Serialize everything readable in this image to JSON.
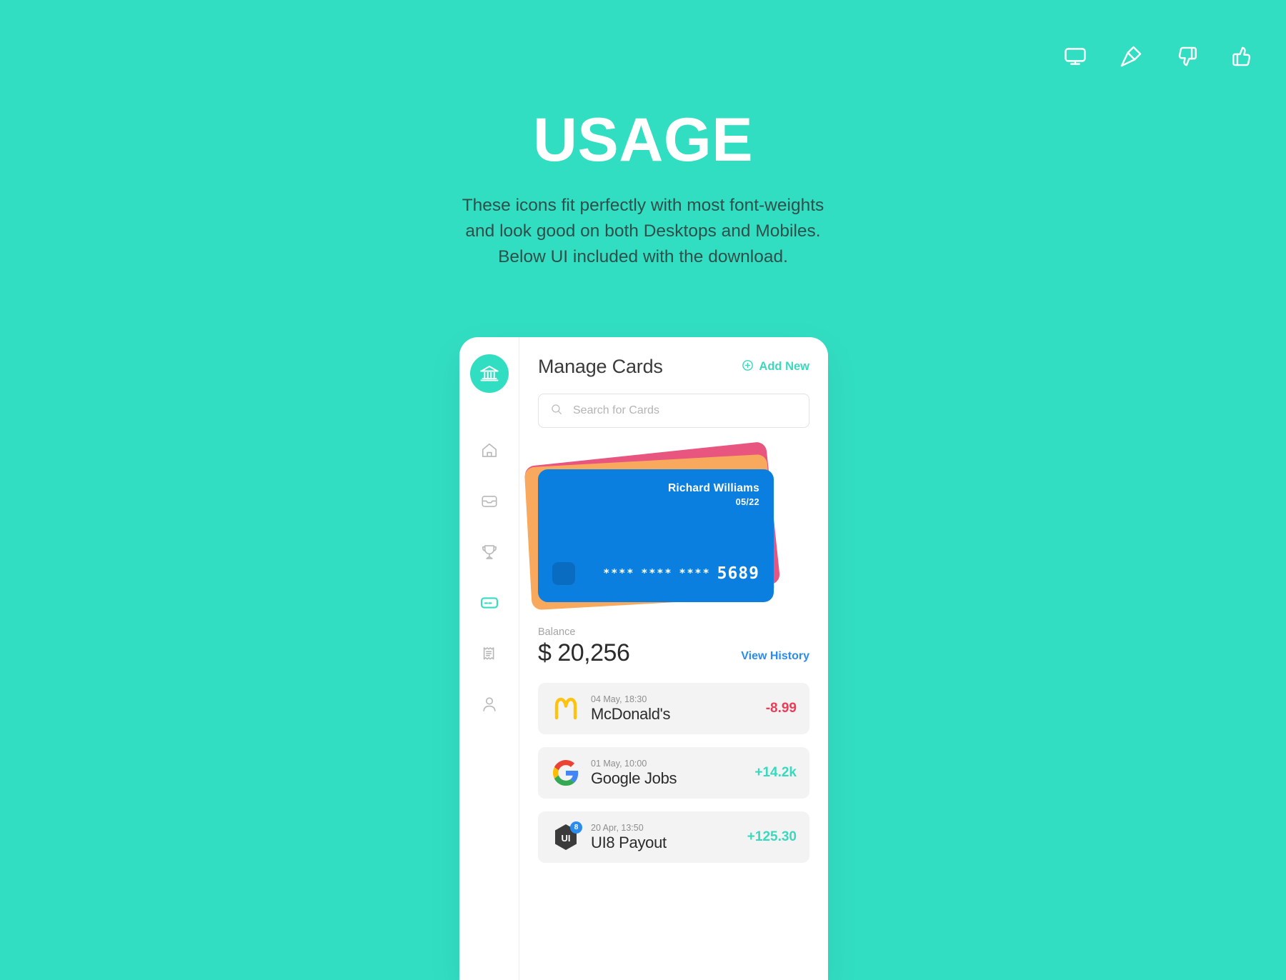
{
  "topbar": {
    "icons": [
      {
        "name": "monitor-icon",
        "label": "Monitor"
      },
      {
        "name": "pin-icon",
        "label": "Pin"
      },
      {
        "name": "thumbs-down-icon",
        "label": "Thumbs Down"
      },
      {
        "name": "thumbs-up-icon",
        "label": "Thumbs Up"
      }
    ]
  },
  "hero": {
    "title": "USAGE",
    "subtitle_line1": "These icons fit perfectly with most font-weights",
    "subtitle_line2": "and look good on both Desktops and Mobiles.",
    "subtitle_line3": "Below UI included with the download."
  },
  "app": {
    "sidebar": {
      "brand_icon": "bank-icon",
      "items": [
        {
          "name": "home-icon",
          "label": "Home",
          "active": false
        },
        {
          "name": "inbox-icon",
          "label": "Inbox",
          "active": false
        },
        {
          "name": "trophy-icon",
          "label": "Rewards",
          "active": false
        },
        {
          "name": "card-icon",
          "label": "Cards",
          "active": true
        },
        {
          "name": "receipt-icon",
          "label": "Receipts",
          "active": false
        },
        {
          "name": "user-icon",
          "label": "Profile",
          "active": false
        }
      ]
    },
    "header": {
      "title": "Manage Cards",
      "add_new_label": "Add New",
      "add_new_icon": "circle-plus-icon"
    },
    "search": {
      "placeholder": "Search for Cards",
      "value": "",
      "icon": "search-icon"
    },
    "card": {
      "holder": "Richard Williams",
      "expiry": "05/22",
      "masked_group": "****",
      "last_four": "5689",
      "front_color": "#0b7fe0",
      "mid_color": "#f9a95d",
      "back_color": "#e8557f"
    },
    "balance": {
      "label": "Balance",
      "value": "$ 20,256",
      "history_link": "View History",
      "history_color": "#2b8cf0"
    },
    "transactions": [
      {
        "logo": "mcdonalds-logo",
        "date": "04 May, 18:30",
        "name": "McDonald's",
        "amount": "-8.99",
        "positive": false
      },
      {
        "logo": "google-logo",
        "date": "01 May, 10:00",
        "name": "Google Jobs",
        "amount": "+14.2k",
        "positive": true
      },
      {
        "logo": "ui8-logo",
        "badge": "8",
        "date": "20 Apr, 13:50",
        "name": "UI8 Payout",
        "amount": "+125.30",
        "positive": true
      }
    ]
  },
  "theme": {
    "background": "#32dec2",
    "accent": "#3ad9bd",
    "negative": "#ef3b56",
    "positive": "#3ad9bd"
  }
}
